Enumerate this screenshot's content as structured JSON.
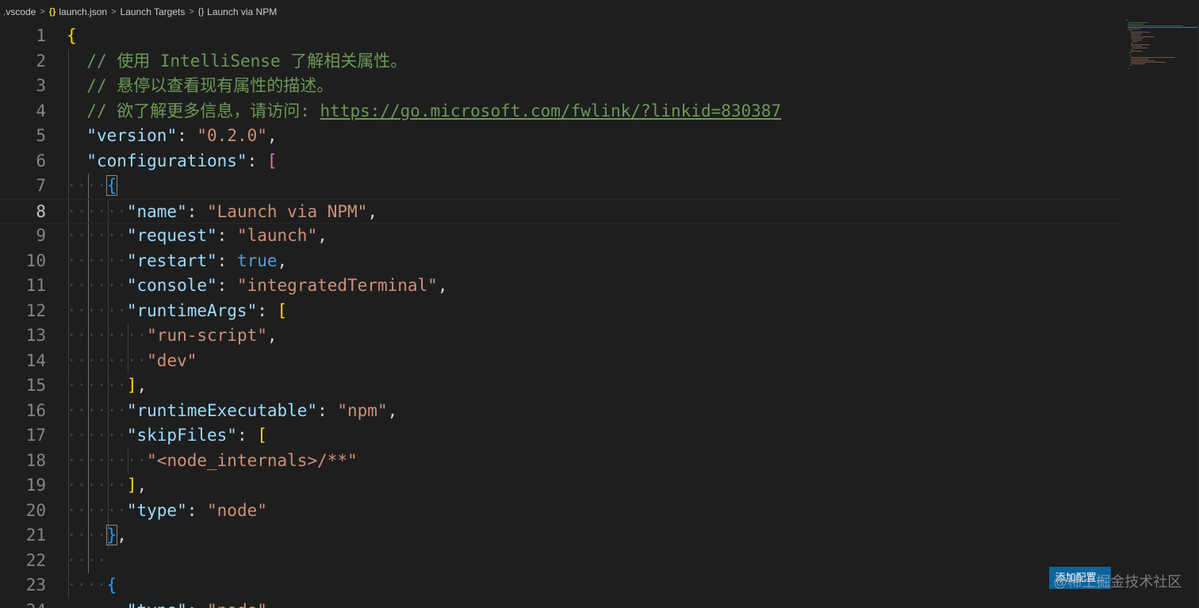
{
  "breadcrumb": {
    "items": [
      ".vscode",
      "launch.json",
      "Launch Targets",
      "Launch via NPM"
    ],
    "separator": ">",
    "json_icon": "{}",
    "object_icon": "{}"
  },
  "editor": {
    "current_line": 8,
    "lines": [
      {
        "n": "1",
        "tokens": [
          [
            "b1",
            "{"
          ]
        ]
      },
      {
        "n": "2",
        "tokens": [
          [
            "ws",
            "  "
          ],
          [
            "cmt",
            "// 使用 IntelliSense 了解相关属性。"
          ]
        ]
      },
      {
        "n": "3",
        "tokens": [
          [
            "ws",
            "  "
          ],
          [
            "cmt",
            "// 悬停以查看现有属性的描述。"
          ]
        ]
      },
      {
        "n": "4",
        "tokens": [
          [
            "ws",
            "  "
          ],
          [
            "cmt",
            "// 欲了解更多信息，请访问: "
          ],
          [
            "cmt link",
            "https://go.microsoft.com/fwlink/?linkid=830387"
          ]
        ]
      },
      {
        "n": "5",
        "tokens": [
          [
            "ws",
            "  "
          ],
          [
            "key",
            "\"version\""
          ],
          [
            "punct",
            ": "
          ],
          [
            "str",
            "\"0.2.0\""
          ],
          [
            "punct",
            ","
          ]
        ]
      },
      {
        "n": "6",
        "tokens": [
          [
            "ws",
            "  "
          ],
          [
            "key",
            "\"configurations\""
          ],
          [
            "punct",
            ": "
          ],
          [
            "b2",
            "["
          ]
        ]
      },
      {
        "n": "7",
        "tokens": [
          [
            "ws",
            "····"
          ],
          [
            "b3 bmatch",
            "{"
          ]
        ]
      },
      {
        "n": "8",
        "tokens": [
          [
            "ws",
            "······"
          ],
          [
            "key",
            "\"name\""
          ],
          [
            "punct",
            ": "
          ],
          [
            "str",
            "\"Launch via NPM\""
          ],
          [
            "punct",
            ","
          ]
        ]
      },
      {
        "n": "9",
        "tokens": [
          [
            "ws",
            "······"
          ],
          [
            "key",
            "\"request\""
          ],
          [
            "punct",
            ": "
          ],
          [
            "str",
            "\"launch\""
          ],
          [
            "punct",
            ","
          ]
        ]
      },
      {
        "n": "10",
        "tokens": [
          [
            "ws",
            "······"
          ],
          [
            "key",
            "\"restart\""
          ],
          [
            "punct",
            ": "
          ],
          [
            "bool",
            "true"
          ],
          [
            "punct",
            ","
          ]
        ]
      },
      {
        "n": "11",
        "tokens": [
          [
            "ws",
            "······"
          ],
          [
            "key",
            "\"console\""
          ],
          [
            "punct",
            ": "
          ],
          [
            "str",
            "\"integratedTerminal\""
          ],
          [
            "punct",
            ","
          ]
        ]
      },
      {
        "n": "12",
        "tokens": [
          [
            "ws",
            "······"
          ],
          [
            "key",
            "\"runtimeArgs\""
          ],
          [
            "punct",
            ": "
          ],
          [
            "b1",
            "["
          ]
        ]
      },
      {
        "n": "13",
        "tokens": [
          [
            "ws",
            "········"
          ],
          [
            "str",
            "\"run-script\""
          ],
          [
            "punct",
            ","
          ]
        ]
      },
      {
        "n": "14",
        "tokens": [
          [
            "ws",
            "········"
          ],
          [
            "str",
            "\"dev\""
          ]
        ]
      },
      {
        "n": "15",
        "tokens": [
          [
            "ws",
            "······"
          ],
          [
            "b1",
            "]"
          ],
          [
            "punct",
            ","
          ]
        ]
      },
      {
        "n": "16",
        "tokens": [
          [
            "ws",
            "······"
          ],
          [
            "key",
            "\"runtimeExecutable\""
          ],
          [
            "punct",
            ": "
          ],
          [
            "str",
            "\"npm\""
          ],
          [
            "punct",
            ","
          ]
        ]
      },
      {
        "n": "17",
        "tokens": [
          [
            "ws",
            "······"
          ],
          [
            "key",
            "\"skipFiles\""
          ],
          [
            "punct",
            ": "
          ],
          [
            "b1",
            "["
          ]
        ]
      },
      {
        "n": "18",
        "tokens": [
          [
            "ws",
            "········"
          ],
          [
            "str",
            "\"<node_internals>/**\""
          ]
        ]
      },
      {
        "n": "19",
        "tokens": [
          [
            "ws",
            "······"
          ],
          [
            "b1",
            "]"
          ],
          [
            "punct",
            ","
          ]
        ]
      },
      {
        "n": "20",
        "tokens": [
          [
            "ws",
            "······"
          ],
          [
            "key",
            "\"type\""
          ],
          [
            "punct",
            ": "
          ],
          [
            "str",
            "\"node\""
          ]
        ]
      },
      {
        "n": "21",
        "tokens": [
          [
            "ws",
            "····"
          ],
          [
            "b3 bmatch",
            "}"
          ],
          [
            "punct",
            ","
          ]
        ]
      },
      {
        "n": "22",
        "tokens": [
          [
            "ws",
            "····"
          ]
        ]
      },
      {
        "n": "23",
        "tokens": [
          [
            "ws",
            "····"
          ],
          [
            "b3",
            "{"
          ]
        ]
      },
      {
        "n": "24",
        "tokens": [
          [
            "ws",
            "······"
          ],
          [
            "key",
            "\"type\""
          ],
          [
            "punct",
            ": "
          ],
          [
            "str",
            "\"node\""
          ]
        ]
      }
    ]
  },
  "add_config_button": {
    "label": "添加配置..."
  },
  "watermark": {
    "text": "@稀土掘金技术社区"
  }
}
